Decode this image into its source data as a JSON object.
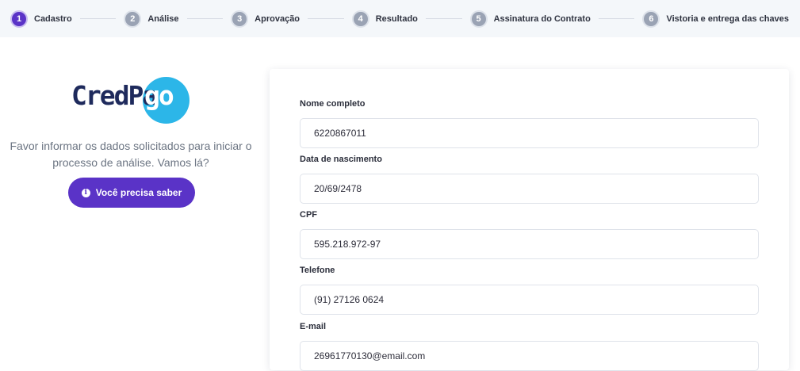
{
  "stepper": {
    "steps": [
      {
        "number": "1",
        "label": "Cadastro"
      },
      {
        "number": "2",
        "label": "Análise"
      },
      {
        "number": "3",
        "label": "Aprovação"
      },
      {
        "number": "4",
        "label": "Resultado"
      },
      {
        "number": "5",
        "label": "Assinatura do Contrato"
      },
      {
        "number": "6",
        "label": "Vistoria e entrega das chaves"
      }
    ],
    "active_step": 1
  },
  "brand": {
    "logo_text_dark": "CredPa",
    "logo_text_light": "go",
    "logo_dark_color": "#1e2a5c",
    "logo_circle_color": "#2cb6e8"
  },
  "intro": {
    "line1": "Favor informar os dados solicitados para iniciar o",
    "line2": "processo de análise. Vamos lá?"
  },
  "info_button": {
    "icon": "info-icon",
    "label": "Você precisa saber"
  },
  "form": {
    "fields": [
      {
        "label": "Nome completo",
        "value": "6220867011"
      },
      {
        "label": "Data de nascimento",
        "value": "20/69/2478"
      },
      {
        "label": "CPF",
        "value": "595.218.972-97"
      },
      {
        "label": "Telefone",
        "value": "(91) 27126 0624"
      },
      {
        "label": "E-mail",
        "value": "26961770130@email.com"
      }
    ]
  },
  "colors": {
    "accent": "#5a33c7",
    "step_inactive": "#9aa3b4",
    "stepper_bg": "#f4f7fa"
  }
}
